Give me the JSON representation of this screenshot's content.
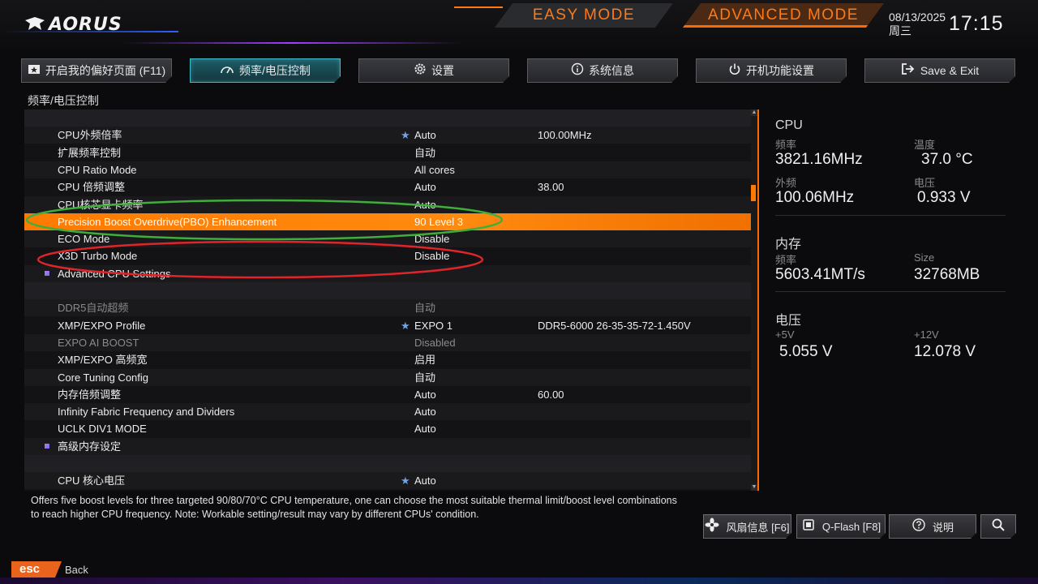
{
  "header": {
    "logo_text": "AORUS",
    "modes": [
      "EASY MODE",
      "ADVANCED MODE"
    ],
    "date": "08/13/2025",
    "weekday": "周三",
    "time": "17:15"
  },
  "tabs": [
    {
      "label": "开启我的偏好页面 (F11)",
      "icon": "favorite-page-icon"
    },
    {
      "label": "频率/电压控制",
      "icon": "speedometer-icon",
      "active": true
    },
    {
      "label": "设置",
      "icon": "gear-icon"
    },
    {
      "label": "系统信息",
      "icon": "info-icon"
    },
    {
      "label": "开机功能设置",
      "icon": "power-icon"
    },
    {
      "label": "Save & Exit",
      "icon": "exit-icon"
    }
  ],
  "breadcrumb": "频率/电压控制",
  "rows": [
    {
      "name": "",
      "value": "",
      "value2": "",
      "type": "blank"
    },
    {
      "name": "CPU外频倍率",
      "value": "Auto",
      "value2": "100.00MHz",
      "star": true
    },
    {
      "name": "扩展频率控制",
      "value": "自动",
      "value2": ""
    },
    {
      "name": "CPU Ratio Mode",
      "value": "All cores",
      "value2": ""
    },
    {
      "name": "CPU 倍频调整",
      "value": "Auto",
      "value2": "38.00"
    },
    {
      "name": "CPU核芯显卡频率",
      "value": "Auto",
      "value2": ""
    },
    {
      "name": "Precision Boost Overdrive(PBO) Enhancement",
      "value": "90 Level 3",
      "value2": "",
      "type": "selected"
    },
    {
      "name": "ECO Mode",
      "value": "Disable",
      "value2": ""
    },
    {
      "name": "X3D Turbo Mode",
      "value": "Disable",
      "value2": ""
    },
    {
      "name": "Advanced CPU Settings",
      "value": "",
      "value2": "",
      "bullet": true
    },
    {
      "name": "",
      "value": "",
      "value2": "",
      "type": "blank"
    },
    {
      "name": "DDR5自动超频",
      "value": "自动",
      "value2": "",
      "type": "dim"
    },
    {
      "name": "XMP/EXPO Profile",
      "value": "EXPO 1",
      "value2": "DDR5-6000 26-35-35-72-1.450V",
      "star": true
    },
    {
      "name": "EXPO AI BOOST",
      "value": "Disabled",
      "value2": "",
      "type": "dim"
    },
    {
      "name": "XMP/EXPO 高频宽",
      "value": "启用",
      "value2": ""
    },
    {
      "name": "Core Tuning Config",
      "value": "自动",
      "value2": ""
    },
    {
      "name": "内存倍频调整",
      "value": "Auto",
      "value2": "60.00"
    },
    {
      "name": "Infinity Fabric Frequency and Dividers",
      "value": "Auto",
      "value2": ""
    },
    {
      "name": "UCLK DIV1 MODE",
      "value": "Auto",
      "value2": ""
    },
    {
      "name": "高级内存设定",
      "value": "",
      "value2": "",
      "bullet": true
    },
    {
      "name": "",
      "value": "",
      "value2": "",
      "type": "blank"
    },
    {
      "name": "CPU 核心电压",
      "value": "Auto",
      "value2": "",
      "star": true
    }
  ],
  "panel": {
    "cpu": {
      "heading": "CPU",
      "freq_label": "频率",
      "freq": "3821.16MHz",
      "temp_label": "温度",
      "temp": "37.0 °C",
      "bclk_label": "外频",
      "bclk": "100.06MHz",
      "volt_label": "电压",
      "volt": "0.933 V"
    },
    "mem": {
      "heading": "内存",
      "freq_label": "频率",
      "freq": "5603.41MT/s",
      "size_label": "Size",
      "size": "32768MB"
    },
    "voltage": {
      "heading": "电压",
      "v5_label": "+5V",
      "v5": "5.055 V",
      "v12_label": "+12V",
      "v12": "12.078 V"
    }
  },
  "help_text": "Offers five boost levels for three targeted 90/80/70°C CPU temperature, one can choose the most suitable thermal limit/boost level combinations to reach higher CPU frequency. Note: Workable setting/result may vary by different CPUs' condition.",
  "buttons": [
    {
      "label": "风扇信息 [F6]",
      "icon": "fan-icon"
    },
    {
      "label": "Q-Flash [F8]",
      "icon": "chip-icon"
    },
    {
      "label": "说明",
      "icon": "help-icon"
    },
    {
      "label": "",
      "icon": "search-icon"
    }
  ],
  "esc": {
    "label": "esc",
    "back": "Back"
  },
  "colors": {
    "accent": "#ff7a00",
    "active_tab": "#3fb8c8",
    "highlight_green": "#3fae3a",
    "highlight_red": "#e0252a"
  }
}
